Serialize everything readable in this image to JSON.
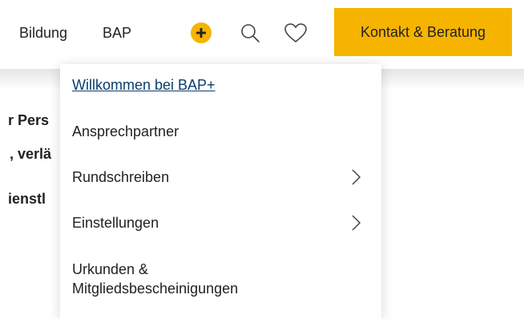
{
  "header": {
    "nav": {
      "bildung": "Bildung",
      "bap": "BAP"
    },
    "icons": {
      "plus": "plus-circle-icon",
      "search": "search-icon",
      "heart": "heart-icon"
    },
    "cta_label": "Kontakt & Beratung"
  },
  "background": {
    "line1": "r Pers",
    "line2": ", verlä",
    "line3": "ienstl"
  },
  "dropdown": {
    "items": [
      {
        "label": "Willkommen bei BAP+",
        "active": true
      },
      {
        "label": "Ansprechpartner"
      },
      {
        "label": "Rundschreiben",
        "submenu": true
      },
      {
        "label": "Einstellungen",
        "submenu": true
      },
      {
        "label": "Urkunden & Mitgliedsbescheinigungen"
      }
    ]
  },
  "colors": {
    "accent": "#f6b400",
    "link": "#0b3c6a",
    "text": "#222222"
  }
}
